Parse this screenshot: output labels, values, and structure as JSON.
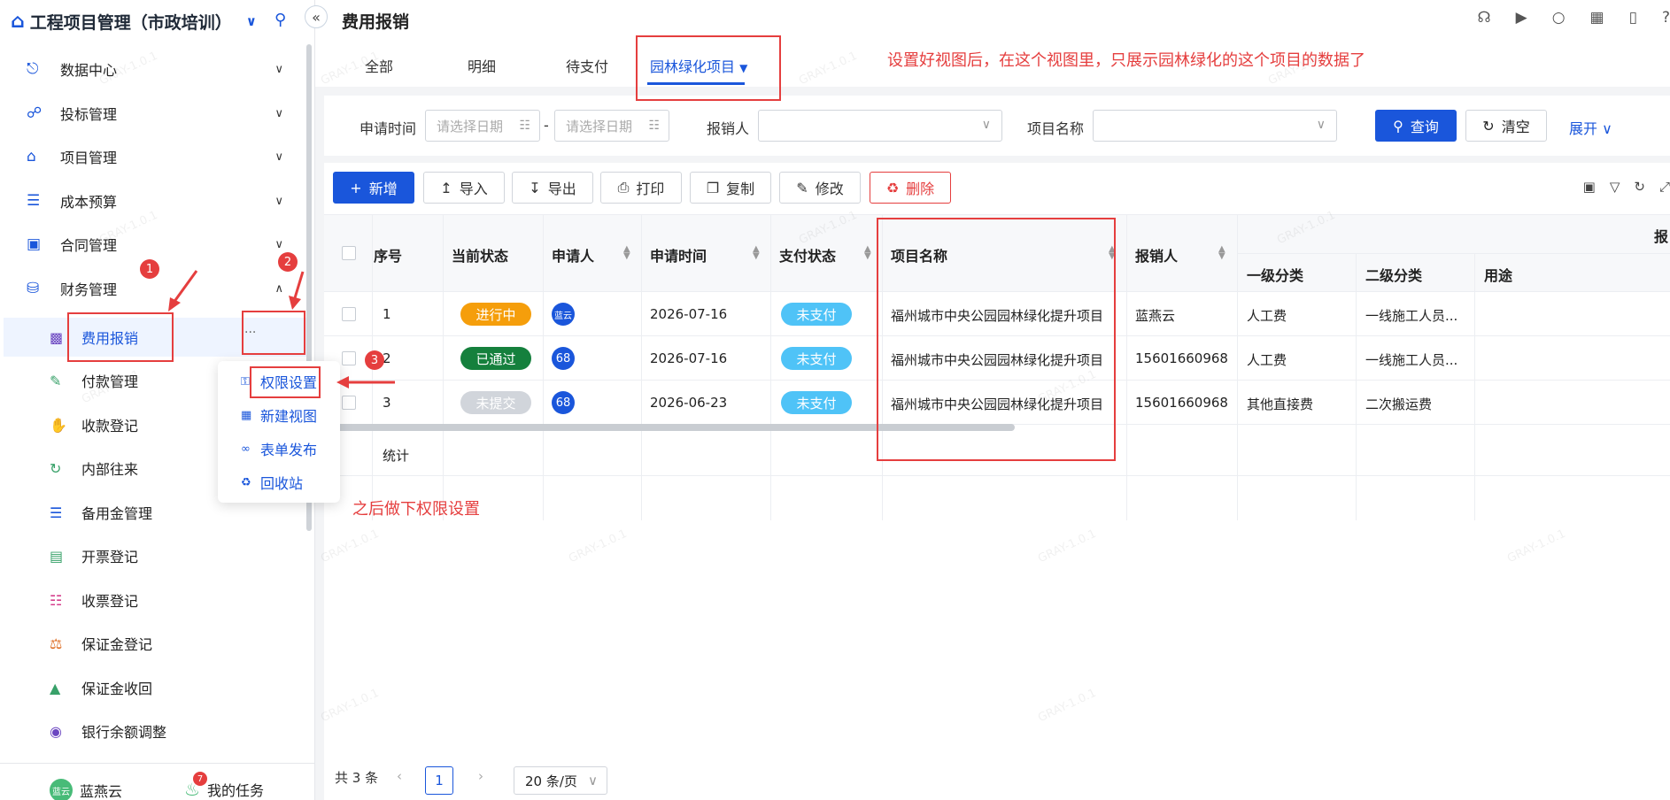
{
  "app": {
    "title": "工程项目管理（市政培训）"
  },
  "sidebar": {
    "menus": [
      {
        "label": "数据中心",
        "icon": "compass-icon"
      },
      {
        "label": "投标管理",
        "icon": "share-icon"
      },
      {
        "label": "项目管理",
        "icon": "house-icon"
      },
      {
        "label": "成本预算",
        "icon": "layers-icon"
      },
      {
        "label": "合同管理",
        "icon": "briefcase-icon"
      },
      {
        "label": "财务管理",
        "icon": "coins-icon"
      }
    ],
    "sub_items": [
      {
        "label": "费用报销",
        "icon": "expense-icon"
      },
      {
        "label": "付款管理",
        "icon": "edit-icon"
      },
      {
        "label": "收款登记",
        "icon": "hand-coin-icon"
      },
      {
        "label": "内部往来",
        "icon": "refresh-icon"
      },
      {
        "label": "备用金管理",
        "icon": "stack-icon"
      },
      {
        "label": "开票登记",
        "icon": "invoice-icon"
      },
      {
        "label": "收票登记",
        "icon": "barcode-icon"
      },
      {
        "label": "保证金登记",
        "icon": "scale-icon"
      },
      {
        "label": "保证金收回",
        "icon": "chart-up-icon"
      },
      {
        "label": "银行余额调整",
        "icon": "money-bag-icon"
      }
    ],
    "more": "···",
    "user": {
      "name": "蓝燕云",
      "avatar": "蓝云"
    },
    "task": {
      "label": "我的任务",
      "count": "7"
    }
  },
  "popup": {
    "items": [
      "权限设置",
      "新建视图",
      "表单发布",
      "回收站"
    ]
  },
  "header": {
    "page_title": "费用报销"
  },
  "tabs": [
    "全部",
    "明细",
    "待支付",
    "园林绿化项目"
  ],
  "filter": {
    "apply_time_label": "申请时间",
    "date_placeholder": "请选择日期",
    "date_sep": "-",
    "applicant_label": "报销人",
    "project_label": "项目名称",
    "query": "查询",
    "clear": "清空",
    "expand": "展开"
  },
  "toolbar": {
    "add": "新增",
    "import": "导入",
    "export": "导出",
    "print": "打印",
    "copy": "复制",
    "edit": "修改",
    "delete": "删除"
  },
  "table": {
    "headers": {
      "seq": "序号",
      "status": "当前状态",
      "applicant": "申请人",
      "apply_time": "申请时间",
      "pay_status": "支付状态",
      "project": "项目名称",
      "reimburser": "报销人",
      "group": "报",
      "cat1": "一级分类",
      "cat2": "二级分类",
      "usage": "用途"
    },
    "rows": [
      {
        "seq": "1",
        "status": "进行中",
        "status_color": "#f59e0b",
        "avatar": "蓝云",
        "time": "2026-07-16",
        "pay": "未支付",
        "project": "福州城市中央公园园林绿化提升项目",
        "reimburser": "蓝燕云",
        "cat1": "人工费",
        "cat2": "一线施工人员..."
      },
      {
        "seq": "2",
        "status": "已通过",
        "status_color": "#15803d",
        "avatar": "68",
        "time": "2026-07-16",
        "pay": "未支付",
        "project": "福州城市中央公园园林绿化提升项目",
        "reimburser": "15601660968",
        "cat1": "人工费",
        "cat2": "一线施工人员..."
      },
      {
        "seq": "3",
        "status": "未提交",
        "status_color": "#d1d5db",
        "avatar": "68",
        "time": "2026-06-23",
        "pay": "未支付",
        "project": "福州城市中央公园园林绿化提升项目",
        "reimburser": "15601660968",
        "cat1": "其他直接费",
        "cat2": "二次搬运费"
      }
    ],
    "summary": "统计"
  },
  "pagination": {
    "total": "共 3 条",
    "page": "1",
    "size": "20 条/页"
  },
  "annotations": {
    "note_view": "设置好视图后，在这个视图里，只展示园林绿化的这个项目的数据了",
    "note_perm": "之后做下权限设置",
    "n1": "1",
    "n2": "2",
    "n3": "3"
  },
  "watermark": "GRAY-1.0.1",
  "colors": {
    "primary": "#1a56db",
    "annotation": "#e53e3e",
    "pay_tag": "#4fc3f7"
  }
}
